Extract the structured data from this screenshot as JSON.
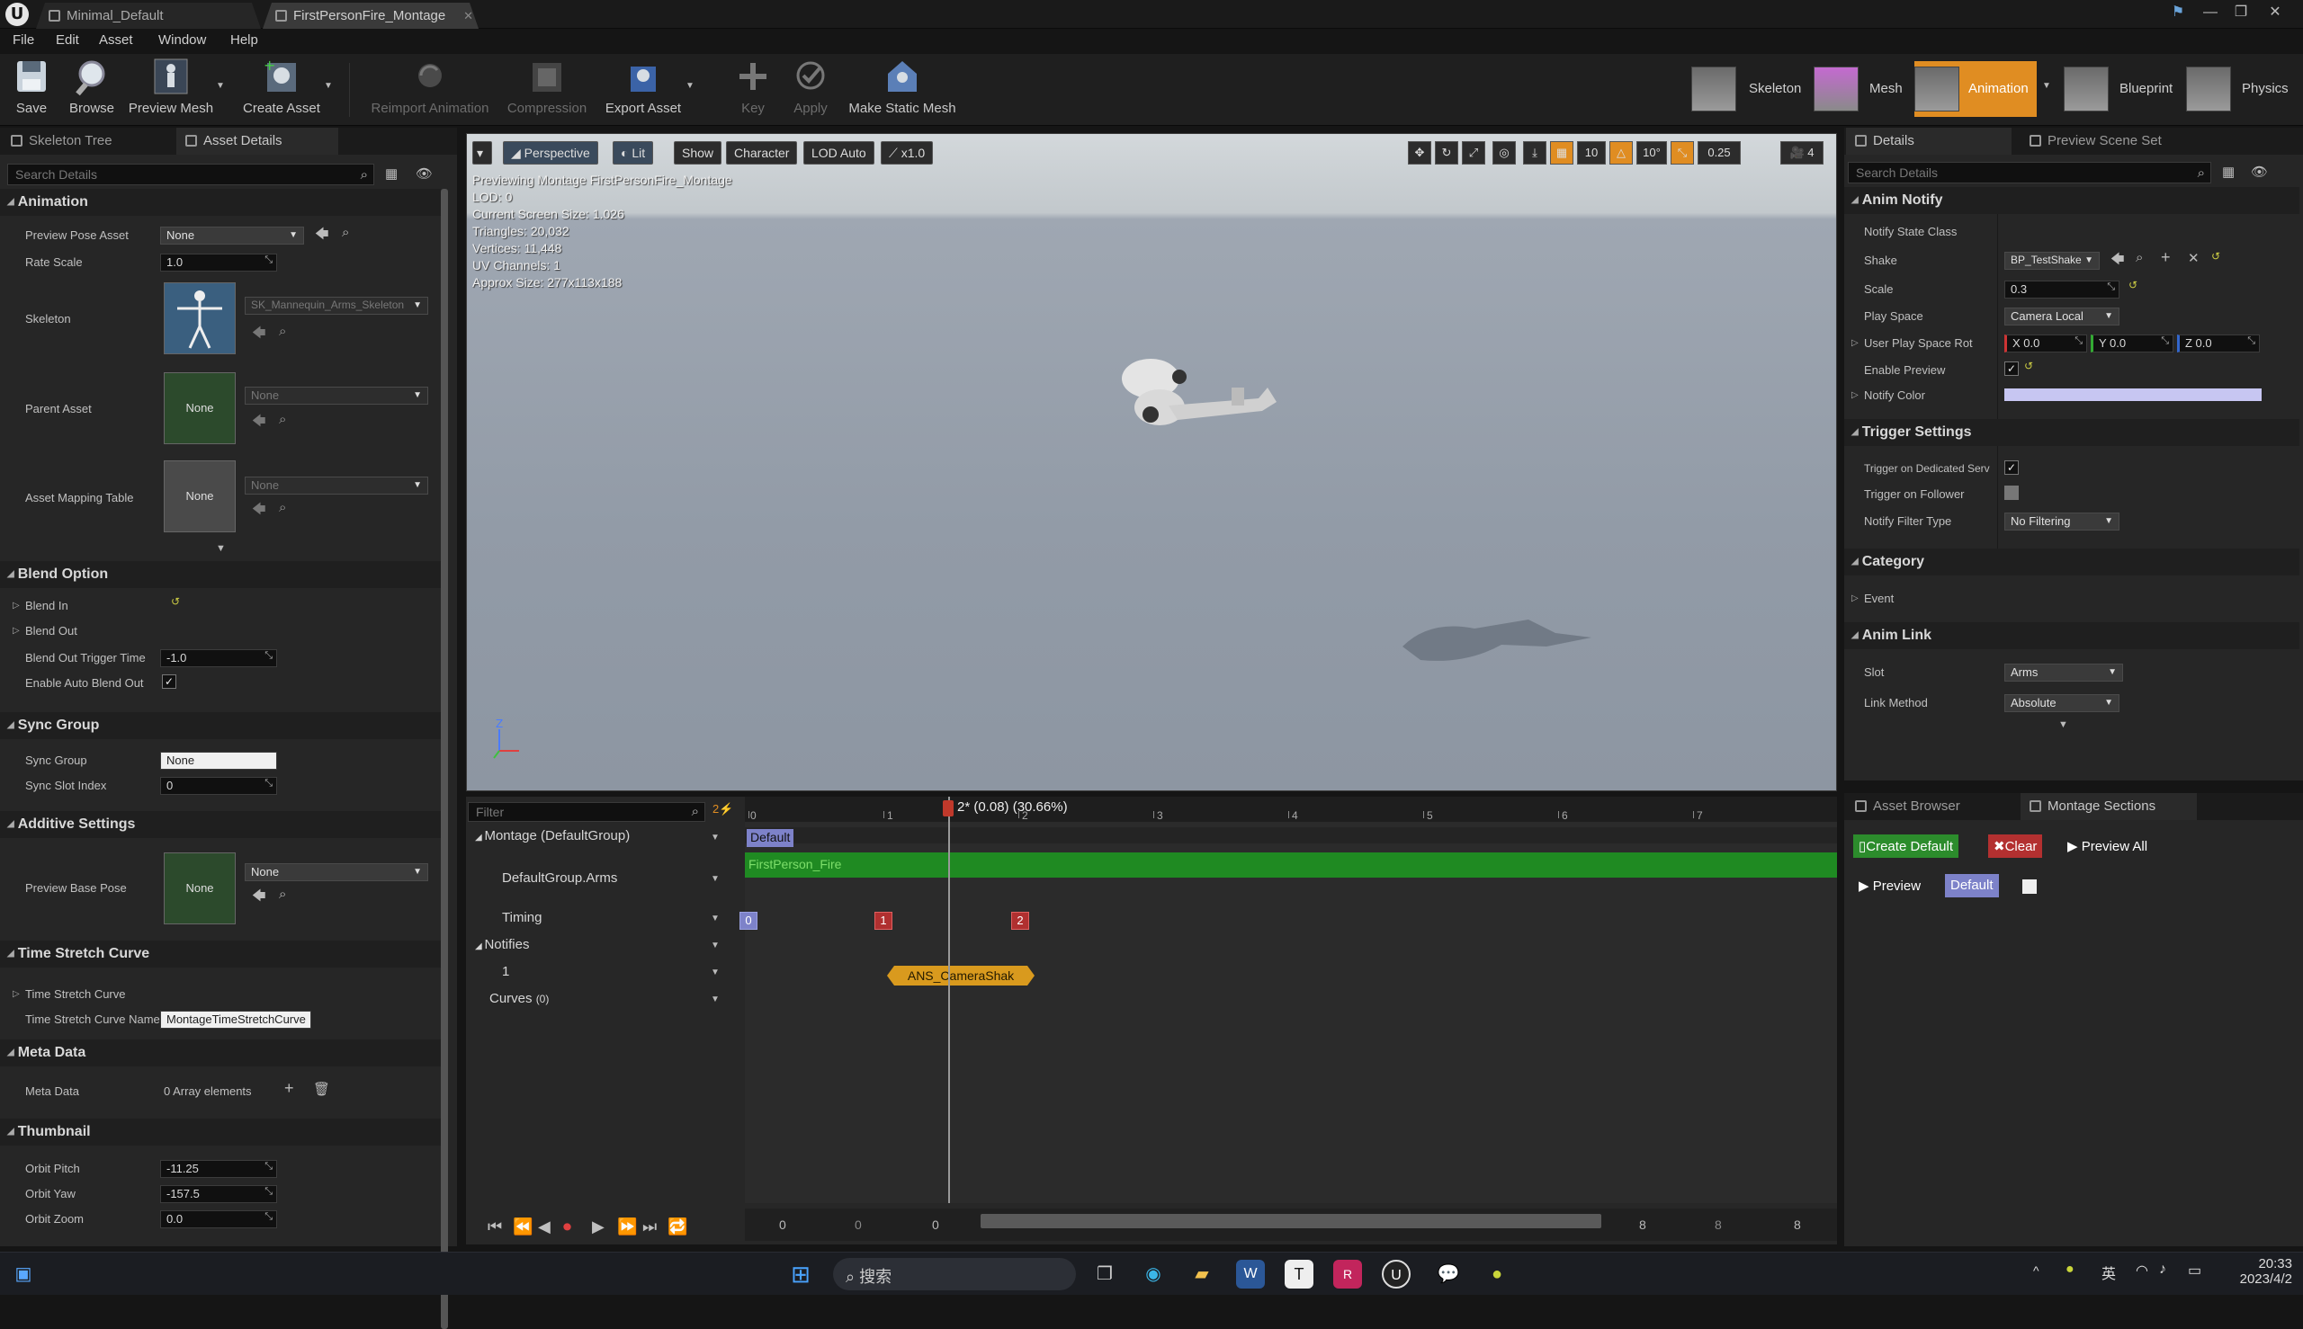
{
  "titlebar": {
    "tabs": [
      {
        "label": "Minimal_Default"
      },
      {
        "label": "FirstPersonFire_Montage"
      }
    ],
    "buttons": {
      "minimize": "—",
      "restore": "❐",
      "close": "✕"
    }
  },
  "menu": [
    "File",
    "Edit",
    "Asset",
    "Window",
    "Help"
  ],
  "toolbar": {
    "buttons": [
      "Save",
      "Browse",
      "Preview Mesh",
      "Create Asset",
      "Reimport Animation",
      "Compression",
      "Export Asset",
      "Key",
      "Apply",
      "Make Static Mesh"
    ],
    "modes": [
      "Skeleton",
      "Mesh",
      "Animation",
      "Blueprint",
      "Physics"
    ]
  },
  "left": {
    "tabs": [
      "Skeleton Tree",
      "Asset Details"
    ],
    "search_placeholder": "Search Details",
    "animation": {
      "title": "Animation",
      "preview_pose_asset": {
        "label": "Preview Pose Asset",
        "value": "None"
      },
      "rate_scale": {
        "label": "Rate Scale",
        "value": "1.0"
      },
      "skeleton": {
        "label": "Skeleton",
        "value": "SK_Mannequin_Arms_Skeleton"
      },
      "parent_asset": {
        "label": "Parent Asset",
        "value": "None",
        "thumb": "None"
      },
      "asset_mapping_table": {
        "label": "Asset Mapping Table",
        "value": "None",
        "thumb": "None"
      }
    },
    "blend_option": {
      "title": "Blend Option",
      "blend_in": "Blend In",
      "blend_out": "Blend Out",
      "blend_out_trigger_time": {
        "label": "Blend Out Trigger Time",
        "value": "-1.0"
      },
      "enable_auto_blend_out": {
        "label": "Enable Auto Blend Out",
        "checked": true
      }
    },
    "sync_group": {
      "title": "Sync Group",
      "sync_group": {
        "label": "Sync Group",
        "value": "None"
      },
      "sync_slot_index": {
        "label": "Sync Slot Index",
        "value": "0"
      }
    },
    "additive_settings": {
      "title": "Additive Settings",
      "preview_base_pose": {
        "label": "Preview Base Pose",
        "value": "None",
        "thumb": "None"
      }
    },
    "time_stretch_curve": {
      "title": "Time Stretch Curve",
      "curve": "Time Stretch Curve",
      "curve_name": {
        "label": "Time Stretch Curve Name",
        "value": "MontageTimeStretchCurve"
      }
    },
    "meta_data": {
      "title": "Meta Data",
      "label": "Meta Data",
      "value": "0 Array elements"
    },
    "thumbnail": {
      "title": "Thumbnail",
      "orbit_pitch": {
        "label": "Orbit Pitch",
        "value": "-11.25"
      },
      "orbit_yaw": {
        "label": "Orbit Yaw",
        "value": "-157.5"
      },
      "orbit_zoom": {
        "label": "Orbit Zoom",
        "value": "0.0"
      }
    }
  },
  "viewport": {
    "buttons": {
      "perspective": "Perspective",
      "lit": "Lit",
      "show": "Show",
      "character": "Character",
      "lod": "LOD Auto",
      "speed": "x1.0"
    },
    "right_values": {
      "grid": "10",
      "angle": "10°",
      "scale": "0.25",
      "camera": "4"
    },
    "info": [
      "Previewing Montage FirstPersonFire_Montage",
      "LOD: 0",
      "Current Screen Size: 1.026",
      "Triangles: 20,032",
      "Vertices: 11,448",
      "UV Channels: 1",
      "Approx Size: 277x113x188"
    ],
    "axis": {
      "z": "Z"
    }
  },
  "timeline": {
    "filter_placeholder": "Filter",
    "playhead": "2* (0.08) (30.66%)",
    "ticks": [
      "0",
      "1",
      "2",
      "3",
      "4",
      "5",
      "6",
      "7"
    ],
    "tracks": {
      "montage": "Montage (DefaultGroup)",
      "group": "DefaultGroup.Arms",
      "timing": "Timing",
      "notifies": "Notifies",
      "notify_track": "1",
      "curves": "Curves",
      "curves_count": "(0)"
    },
    "section_label": "Default",
    "segment_label": "FirstPerson_Fire",
    "markers": [
      "0",
      "1",
      "2"
    ],
    "notify_label": "ANS_CameraShak",
    "bottom_values": [
      "0",
      "0",
      "0",
      "8",
      "8",
      "8"
    ]
  },
  "details": {
    "tabs": [
      "Details",
      "Preview Scene Set"
    ],
    "search_placeholder": "Search Details",
    "anim_notify": {
      "title": "Anim Notify",
      "notify_state_class": "Notify State Class",
      "shake": {
        "label": "Shake",
        "value": "BP_TestShake"
      },
      "scale": {
        "label": "Scale",
        "value": "0.3"
      },
      "play_space": {
        "label": "Play Space",
        "value": "Camera Local"
      },
      "user_play_space_rot": {
        "label": "User Play Space Rot",
        "x": "X 0.0",
        "y": "Y 0.0",
        "z": "Z 0.0"
      },
      "enable_preview": {
        "label": "Enable Preview",
        "checked": true
      },
      "notify_color": {
        "label": "Notify Color",
        "color": "#c7c6f2"
      }
    },
    "trigger_settings": {
      "title": "Trigger Settings",
      "dedicated": {
        "label": "Trigger on Dedicated Serv",
        "checked": true
      },
      "follower": {
        "label": "Trigger on Follower",
        "checked": false
      },
      "filter_type": {
        "label": "Notify Filter Type",
        "value": "No Filtering"
      }
    },
    "category": {
      "title": "Category",
      "event": "Event"
    },
    "anim_link": {
      "title": "Anim Link",
      "slot": {
        "label": "Slot",
        "value": "Arms"
      },
      "link_method": {
        "label": "Link Method",
        "value": "Absolute"
      }
    }
  },
  "sections": {
    "tabs": [
      "Asset Browser",
      "Montage Sections"
    ],
    "create_default": "Create Default",
    "clear": "Clear",
    "preview_all": "Preview All",
    "preview": "Preview",
    "default_section": "Default"
  },
  "taskbar": {
    "search_placeholder": "搜索",
    "ime": "英",
    "time": "20:33",
    "date": "2023/4/2"
  },
  "colors": {
    "accent": "#e08d22",
    "green_track": "#1f8a22",
    "marker_red": "#b03030",
    "notify_gold": "#d99a1e"
  }
}
